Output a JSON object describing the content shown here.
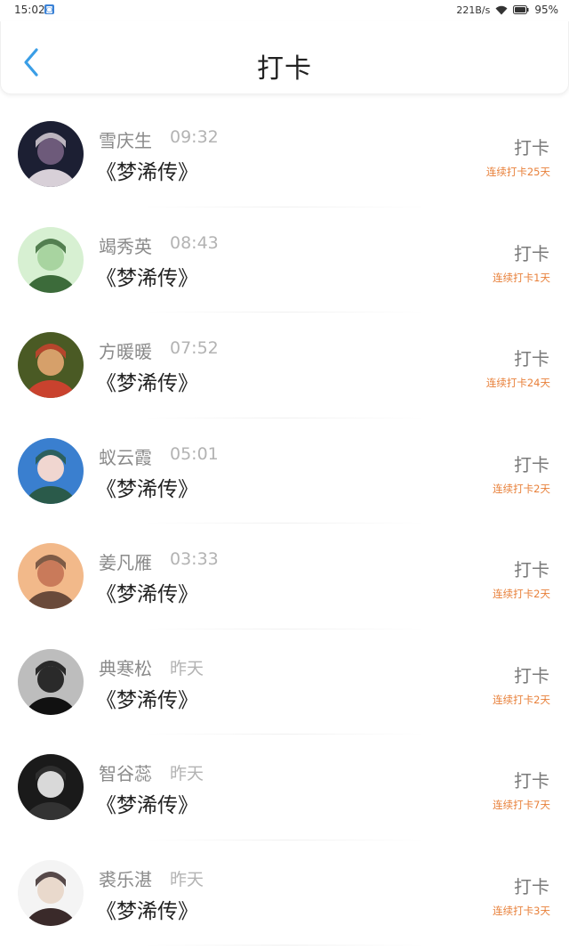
{
  "status_bar": {
    "time": "15:02",
    "net_speed": "221B/s",
    "battery": "95%"
  },
  "header": {
    "title": "打卡",
    "back_icon": "chevron-left-icon",
    "accent": "#3a9ee6"
  },
  "colors": {
    "streak": "#e8803a"
  },
  "entries": [
    {
      "name": "雪庆生",
      "time": "09:32",
      "book": "《梦浠传》",
      "action": "打卡",
      "streak": "连续打卡25天",
      "avatar": [
        "#1c1f33",
        "#6d5a7a",
        "#d8d0d8"
      ]
    },
    {
      "name": "竭秀英",
      "time": "08:43",
      "book": "《梦浠传》",
      "action": "打卡",
      "streak": "连续打卡1天",
      "avatar": [
        "#d7f0d2",
        "#a8d4a0",
        "#3c6b3a"
      ]
    },
    {
      "name": "方暖暖",
      "time": "07:52",
      "book": "《梦浠传》",
      "action": "打卡",
      "streak": "连续打卡24天",
      "avatar": [
        "#4a5a24",
        "#d6a06a",
        "#c9422e"
      ]
    },
    {
      "name": "蚁云霞",
      "time": "05:01",
      "book": "《梦浠传》",
      "action": "打卡",
      "streak": "连续打卡2天",
      "avatar": [
        "#3a7fcf",
        "#f0d6d0",
        "#2a5a4a"
      ]
    },
    {
      "name": "姜凡雁",
      "time": "03:33",
      "book": "《梦浠传》",
      "action": "打卡",
      "streak": "连续打卡2天",
      "avatar": [
        "#f2b98a",
        "#c97a5a",
        "#6a4a3a"
      ]
    },
    {
      "name": "典寒松",
      "time": "昨天",
      "book": "《梦浠传》",
      "action": "打卡",
      "streak": "连续打卡2天",
      "avatar": [
        "#bdbdbd",
        "#2a2a2a",
        "#111111"
      ]
    },
    {
      "name": "智谷蕊",
      "time": "昨天",
      "book": "《梦浠传》",
      "action": "打卡",
      "streak": "连续打卡7天",
      "avatar": [
        "#1a1a1a",
        "#d9d9d9",
        "#333333"
      ]
    },
    {
      "name": "裘乐湛",
      "time": "昨天",
      "book": "《梦浠传》",
      "action": "打卡",
      "streak": "连续打卡3天",
      "avatar": [
        "#f4f4f4",
        "#e9d9cc",
        "#3a2a2a"
      ]
    }
  ]
}
